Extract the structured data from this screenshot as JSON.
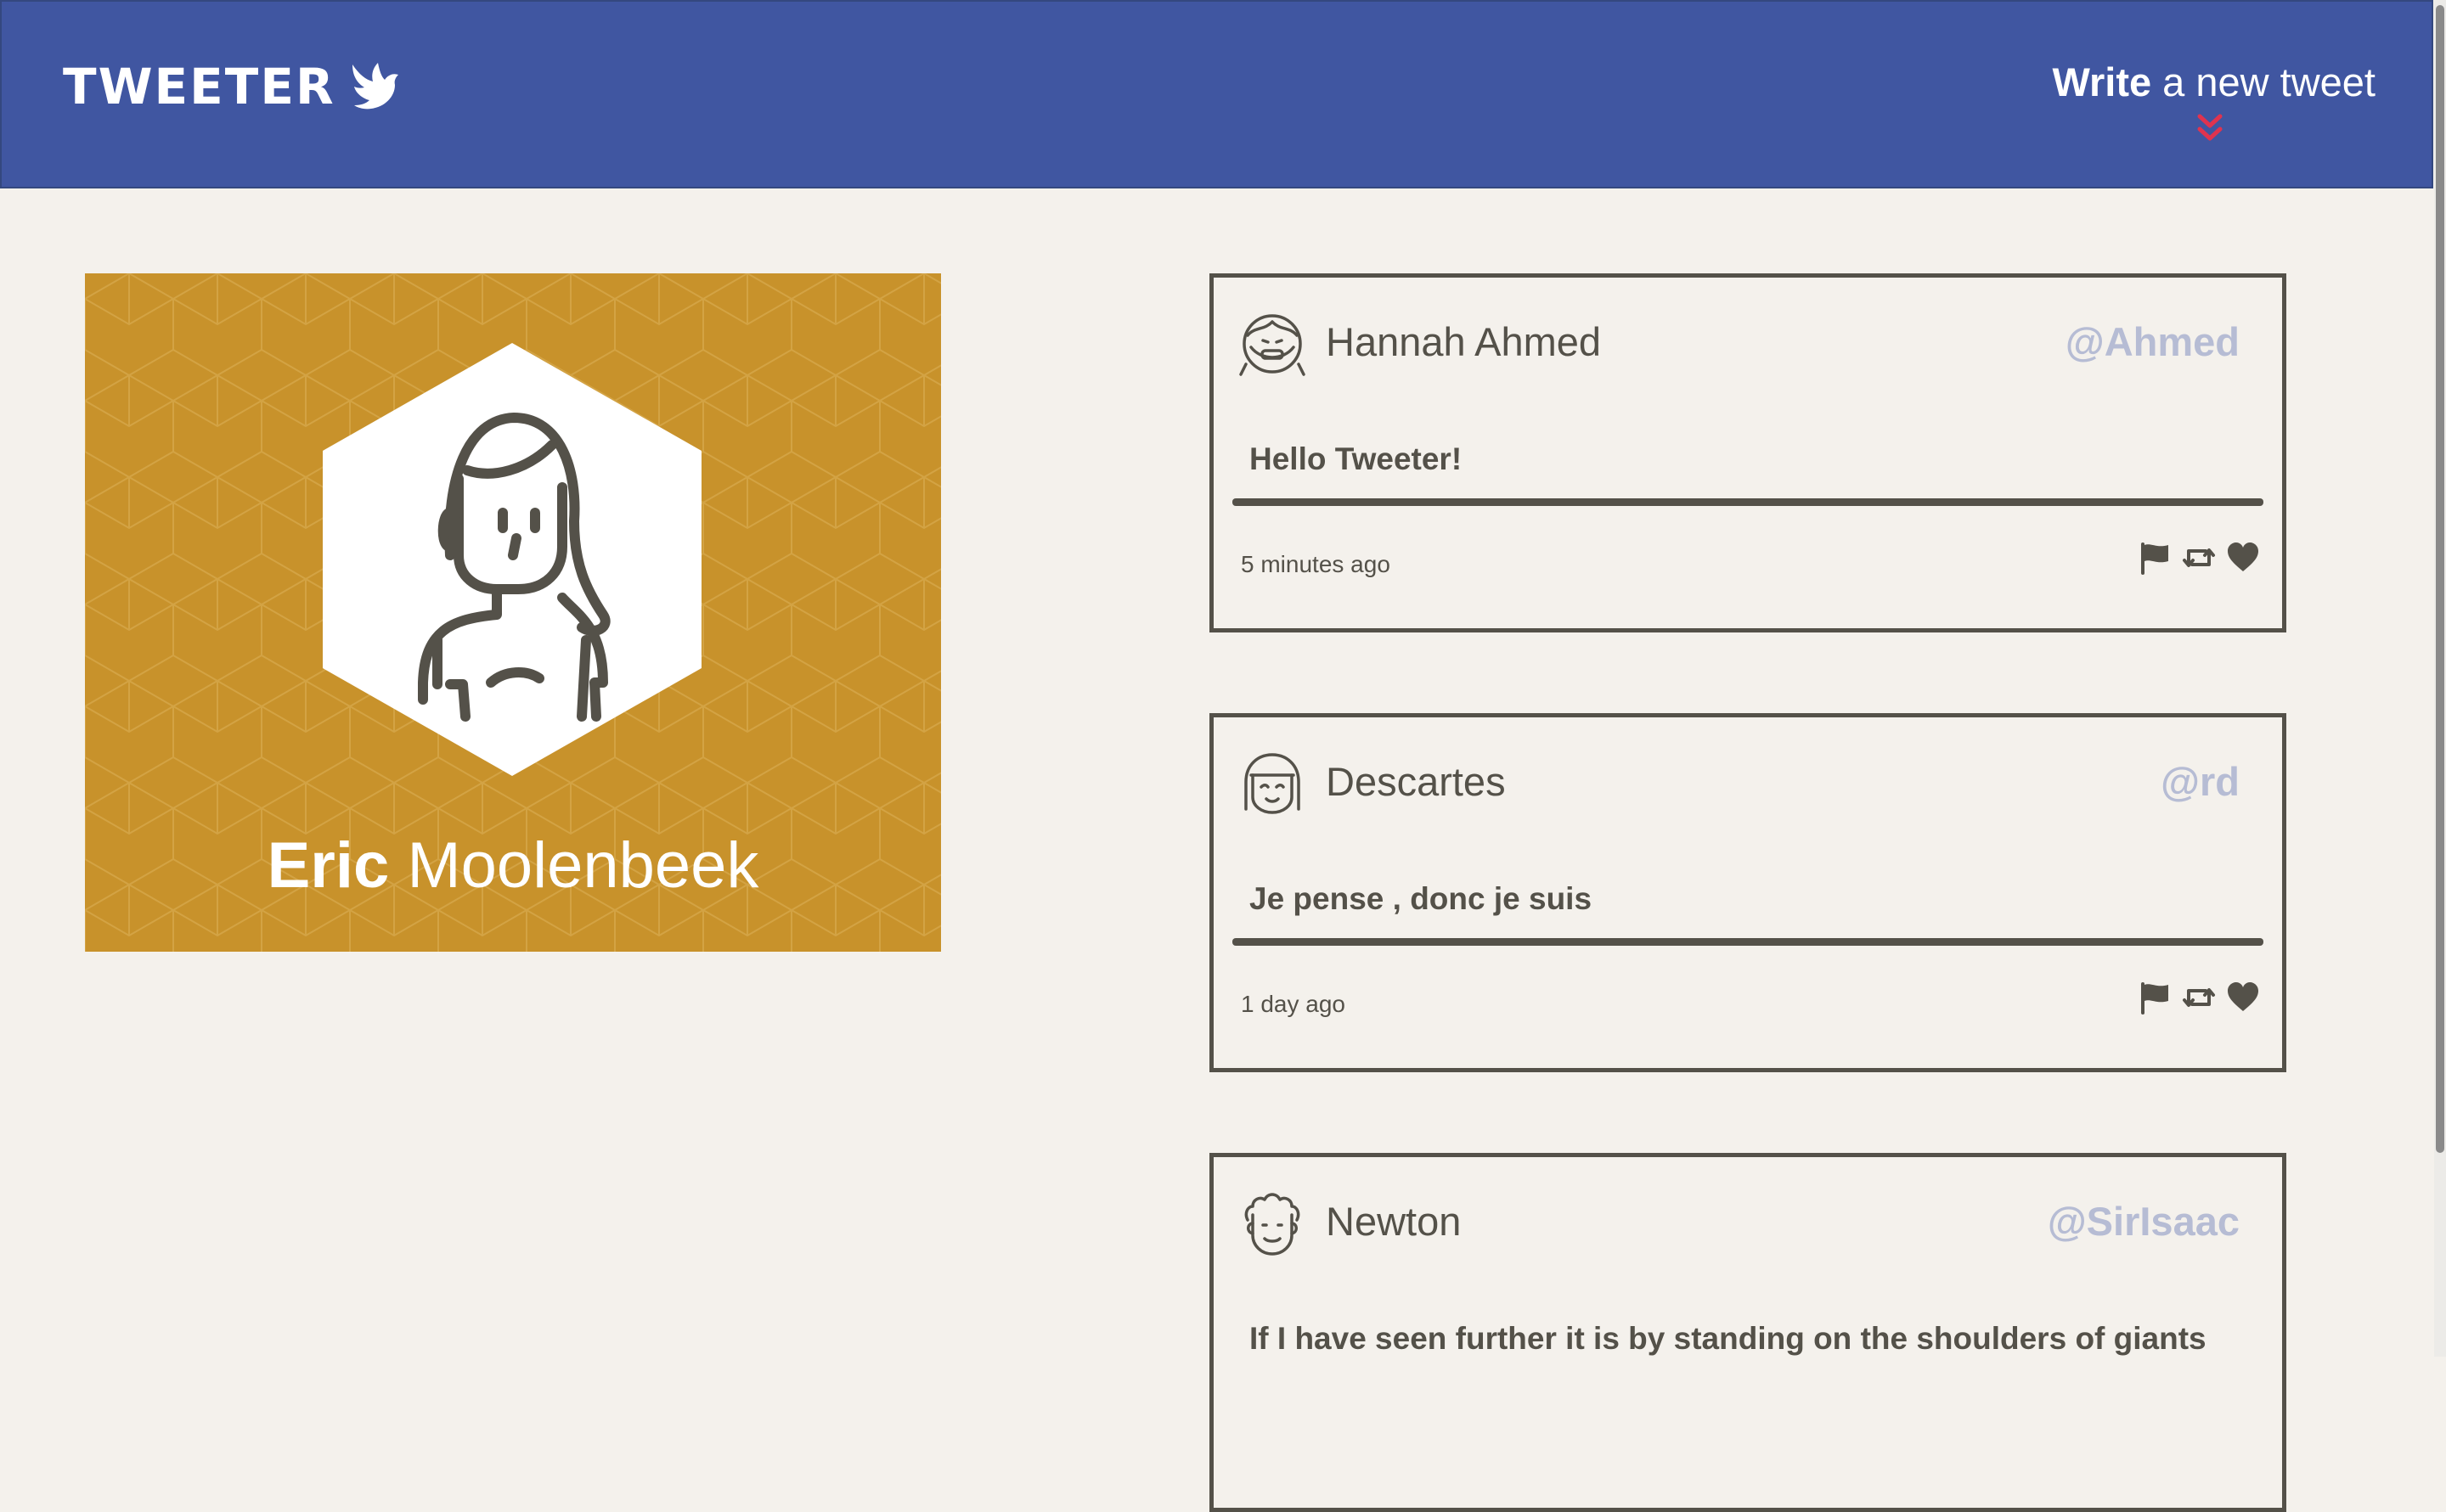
{
  "nav": {
    "logo_text": "TWEETER",
    "compose_bold": "Write",
    "compose_rest": " a new tweet",
    "logo_icon": "bird-icon",
    "compose_arrow_icon": "double-chevron-down-icon",
    "colors": {
      "nav_bg": "#4056a1",
      "arrow": "#e0334f",
      "text": "#ffffff"
    }
  },
  "profile": {
    "first_name": "Eric",
    "last_name": "Moolenbeek",
    "avatar_icon": "user-avatar-icon",
    "colors": {
      "card_bg": "#c8922b"
    }
  },
  "tweets": [
    {
      "name": "Hannah Ahmed",
      "handle": "@Ahmed",
      "text": "Hello Tweeter!",
      "time": "5 minutes ago",
      "avatar_icon": "girl-avatar-icon"
    },
    {
      "name": "Descartes",
      "handle": "@rd",
      "text": "Je pense , donc je suis",
      "time": "1 day ago",
      "avatar_icon": "bob-hair-avatar-icon"
    },
    {
      "name": "Newton",
      "handle": "@SirIsaac",
      "text": "If I have seen further it is by standing on the shoulders of giants",
      "time": "",
      "avatar_icon": "curly-hair-avatar-icon"
    }
  ],
  "tweet_actions": [
    "flag-icon",
    "retweet-icon",
    "heart-icon"
  ],
  "colors": {
    "page_bg": "#f4f1ec",
    "text": "#545149",
    "handle": "#b6bcd4"
  }
}
